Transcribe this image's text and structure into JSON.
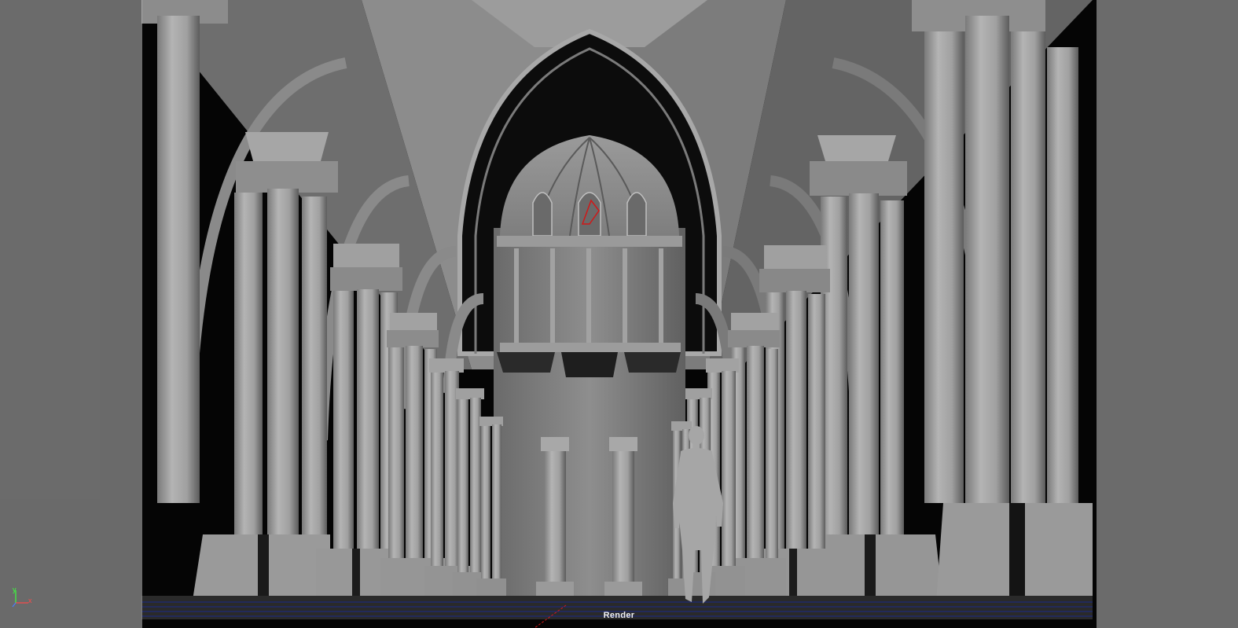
{
  "viewport": {
    "camera_label": "Render",
    "axes": {
      "x": "x",
      "y": "y",
      "z": "z"
    }
  },
  "colors": {
    "axis_x": "#ff4a4a",
    "axis_y": "#3cff3c",
    "axis_z": "#4a7cff",
    "grid_line": "#1a2a8a",
    "selection": "#d01818"
  }
}
